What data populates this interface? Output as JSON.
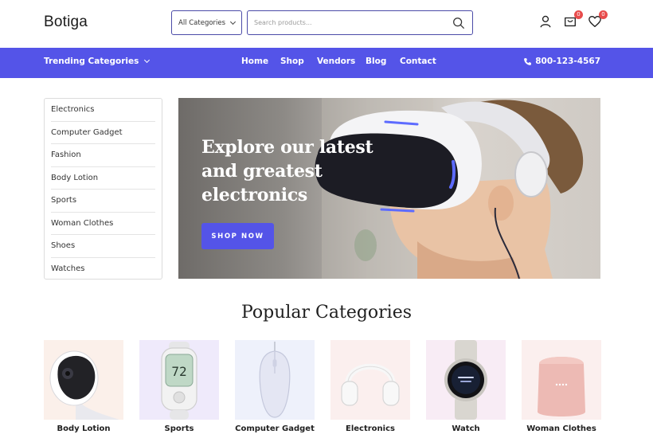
{
  "header": {
    "logo": "Botiga",
    "category_select": "All Categories",
    "search_placeholder": "Search products...",
    "cart_count": "0",
    "wishlist_count": "0"
  },
  "nav": {
    "trending": "Trending Categories",
    "links": [
      "Home",
      "Shop",
      "Vendors",
      "Blog",
      "Contact"
    ],
    "phone": "800-123-4567"
  },
  "sidebar": {
    "items": [
      "Electronics",
      "Computer Gadget",
      "Fashion",
      "Body Lotion",
      "Sports",
      "Woman Clothes",
      "Shoes",
      "Watches"
    ]
  },
  "hero": {
    "title": "Explore our latest and greatest electronics",
    "button": "SHOP NOW"
  },
  "popular": {
    "title": "Popular Categories",
    "categories": [
      {
        "label": "Body Lotion",
        "icon": "smart-camera-icon",
        "bg": "#fbf0ea"
      },
      {
        "label": "Sports",
        "icon": "fitness-tracker-icon",
        "bg": "#efeafb"
      },
      {
        "label": "Computer Gadget",
        "icon": "mouse-icon",
        "bg": "#eef1fb"
      },
      {
        "label": "Electronics",
        "icon": "headphones-icon",
        "bg": "#fbefee"
      },
      {
        "label": "Watch",
        "icon": "smartwatch-icon",
        "bg": "#f8ecf5"
      },
      {
        "label": "Woman Clothes",
        "icon": "smart-speaker-icon",
        "bg": "#fbefee"
      }
    ]
  },
  "colors": {
    "accent": "#5454e8",
    "badge": "#e84c4c"
  }
}
